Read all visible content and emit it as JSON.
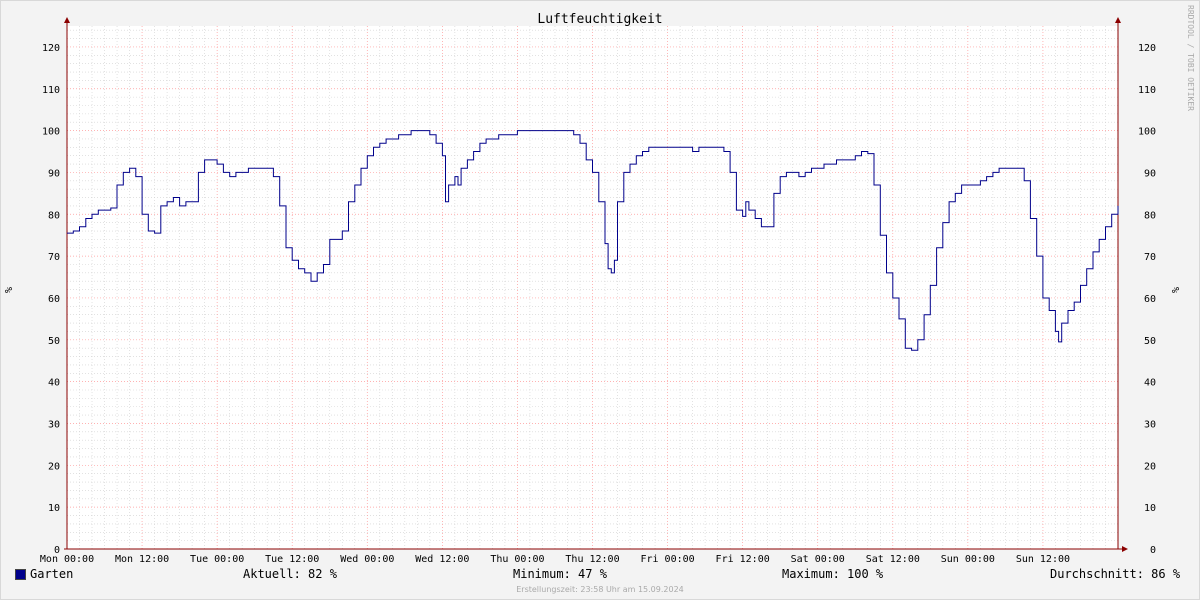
{
  "chart_data": {
    "type": "line",
    "title": "Luftfeuchtigkeit",
    "ylabel": "%",
    "right_ylabel": "%",
    "watermark": "RRDTOOL / TOBI OETIKER",
    "ylim": [
      0,
      125
    ],
    "yticks": [
      "0",
      "10",
      "20",
      "30",
      "40",
      "50",
      "60",
      "70",
      "80",
      "90",
      "100",
      "110",
      "120"
    ],
    "xlim": [
      0,
      168
    ],
    "xticks": [
      {
        "x": 0,
        "label": "Mon 00:00"
      },
      {
        "x": 12,
        "label": "Mon 12:00"
      },
      {
        "x": 24,
        "label": "Tue 00:00"
      },
      {
        "x": 36,
        "label": "Tue 12:00"
      },
      {
        "x": 48,
        "label": "Wed 00:00"
      },
      {
        "x": 60,
        "label": "Wed 12:00"
      },
      {
        "x": 72,
        "label": "Thu 00:00"
      },
      {
        "x": 84,
        "label": "Thu 12:00"
      },
      {
        "x": 96,
        "label": "Fri 00:00"
      },
      {
        "x": 108,
        "label": "Fri 12:00"
      },
      {
        "x": 120,
        "label": "Sat 00:00"
      },
      {
        "x": 132,
        "label": "Sat 12:00"
      },
      {
        "x": 144,
        "label": "Sun 00:00"
      },
      {
        "x": 156,
        "label": "Sun 12:00"
      }
    ],
    "grid": true,
    "series": [
      {
        "name": "Garten",
        "color": "#00008b",
        "points": [
          [
            0,
            75.5
          ],
          [
            1,
            76
          ],
          [
            2,
            77
          ],
          [
            3,
            79
          ],
          [
            4,
            80
          ],
          [
            5,
            81
          ],
          [
            6,
            81
          ],
          [
            7,
            81.5
          ],
          [
            8,
            87
          ],
          [
            9,
            90
          ],
          [
            10,
            91
          ],
          [
            11,
            89
          ],
          [
            12,
            80
          ],
          [
            13,
            76
          ],
          [
            14,
            75.5
          ],
          [
            15,
            82
          ],
          [
            16,
            83
          ],
          [
            17,
            84
          ],
          [
            18,
            82
          ],
          [
            19,
            83
          ],
          [
            20,
            83
          ],
          [
            21,
            90
          ],
          [
            22,
            93
          ],
          [
            23,
            93
          ],
          [
            24,
            92
          ],
          [
            25,
            90
          ],
          [
            26,
            89
          ],
          [
            27,
            90
          ],
          [
            28,
            90
          ],
          [
            29,
            91
          ],
          [
            30,
            91
          ],
          [
            31,
            91
          ],
          [
            32,
            91
          ],
          [
            33,
            89
          ],
          [
            34,
            82
          ],
          [
            35,
            72
          ],
          [
            36,
            69
          ],
          [
            37,
            67
          ],
          [
            38,
            66
          ],
          [
            39,
            64
          ],
          [
            40,
            66
          ],
          [
            41,
            68
          ],
          [
            42,
            74
          ],
          [
            43,
            74
          ],
          [
            44,
            76
          ],
          [
            45,
            83
          ],
          [
            46,
            87
          ],
          [
            47,
            91
          ],
          [
            48,
            94
          ],
          [
            49,
            96
          ],
          [
            50,
            97
          ],
          [
            51,
            98
          ],
          [
            52,
            98
          ],
          [
            53,
            99
          ],
          [
            54,
            99
          ],
          [
            55,
            100
          ],
          [
            56,
            100
          ],
          [
            57,
            100
          ],
          [
            58,
            99
          ],
          [
            59,
            97
          ],
          [
            60,
            94
          ],
          [
            60.5,
            83
          ],
          [
            61,
            87
          ],
          [
            62,
            89
          ],
          [
            62.5,
            87
          ],
          [
            63,
            91
          ],
          [
            64,
            93
          ],
          [
            65,
            95
          ],
          [
            66,
            97
          ],
          [
            67,
            98
          ],
          [
            68,
            98
          ],
          [
            69,
            99
          ],
          [
            70,
            99
          ],
          [
            71,
            99
          ],
          [
            72,
            100
          ],
          [
            73,
            100
          ],
          [
            74,
            100
          ],
          [
            75,
            100
          ],
          [
            76,
            100
          ],
          [
            77,
            100
          ],
          [
            78,
            100
          ],
          [
            79,
            100
          ],
          [
            80,
            100
          ],
          [
            81,
            99
          ],
          [
            82,
            97
          ],
          [
            83,
            93
          ],
          [
            84,
            90
          ],
          [
            85,
            83
          ],
          [
            86,
            73
          ],
          [
            86.5,
            67
          ],
          [
            87,
            66
          ],
          [
            87.5,
            69
          ],
          [
            88,
            83
          ],
          [
            89,
            90
          ],
          [
            90,
            92
          ],
          [
            91,
            94
          ],
          [
            92,
            95
          ],
          [
            93,
            96
          ],
          [
            94,
            96
          ],
          [
            95,
            96
          ],
          [
            96,
            96
          ],
          [
            97,
            96
          ],
          [
            98,
            96
          ],
          [
            99,
            96
          ],
          [
            100,
            95
          ],
          [
            101,
            96
          ],
          [
            102,
            96
          ],
          [
            103,
            96
          ],
          [
            104,
            96
          ],
          [
            105,
            95
          ],
          [
            106,
            90
          ],
          [
            107,
            81
          ],
          [
            108,
            79.5
          ],
          [
            108.5,
            83
          ],
          [
            109,
            81
          ],
          [
            110,
            79
          ],
          [
            111,
            77
          ],
          [
            112,
            77
          ],
          [
            113,
            85
          ],
          [
            114,
            89
          ],
          [
            115,
            90
          ],
          [
            116,
            90
          ],
          [
            117,
            89
          ],
          [
            118,
            90
          ],
          [
            119,
            91
          ],
          [
            120,
            91
          ],
          [
            121,
            92
          ],
          [
            122,
            92
          ],
          [
            123,
            93
          ],
          [
            124,
            93
          ],
          [
            125,
            93
          ],
          [
            126,
            94
          ],
          [
            127,
            95
          ],
          [
            128,
            94.5
          ],
          [
            129,
            87
          ],
          [
            130,
            75
          ],
          [
            131,
            66
          ],
          [
            132,
            60
          ],
          [
            133,
            55
          ],
          [
            134,
            48
          ],
          [
            135,
            47.5
          ],
          [
            136,
            50
          ],
          [
            136.5,
            50
          ],
          [
            137,
            56
          ],
          [
            138,
            63
          ],
          [
            139,
            72
          ],
          [
            140,
            78
          ],
          [
            141,
            83
          ],
          [
            142,
            85
          ],
          [
            143,
            87
          ],
          [
            144,
            87
          ],
          [
            145,
            87
          ],
          [
            146,
            88
          ],
          [
            147,
            89
          ],
          [
            148,
            90
          ],
          [
            149,
            91
          ],
          [
            150,
            91
          ],
          [
            151,
            91
          ],
          [
            152,
            91
          ],
          [
            153,
            88
          ],
          [
            154,
            79
          ],
          [
            155,
            70
          ],
          [
            156,
            60
          ],
          [
            157,
            57
          ],
          [
            158,
            52
          ],
          [
            158.5,
            49.5
          ],
          [
            159,
            54
          ],
          [
            160,
            57
          ],
          [
            161,
            59
          ],
          [
            162,
            63
          ],
          [
            163,
            67
          ],
          [
            164,
            71
          ],
          [
            165,
            74
          ],
          [
            166,
            77
          ],
          [
            167,
            80
          ],
          [
            168,
            82
          ]
        ]
      }
    ]
  },
  "legend": {
    "series_name": "Garten",
    "series_color": "#00008b",
    "aktuell": "Aktuell:  82 %",
    "minimum": "Minimum:  47 %",
    "maximum": "Maximum: 100 %",
    "durchschnitt": "Durchschnitt:  86 %"
  },
  "footer": "Erstellungszeit: 23:58 Uhr am 15.09.2024",
  "colors": {
    "background": "#f3f3f3",
    "plot_bg": "#ffffff",
    "minor_grid": "#d0d0d0",
    "major_grid": "#ff9999",
    "axis": "#8b0000",
    "line": "#00008b"
  }
}
